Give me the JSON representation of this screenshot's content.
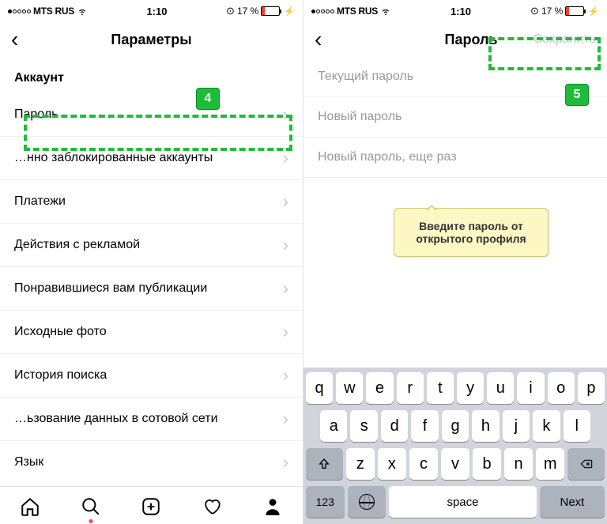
{
  "status": {
    "carrier": "MTS RUS",
    "time": "1:10",
    "battery": "17 %"
  },
  "left": {
    "title": "Параметры",
    "section": "Аккаунт",
    "rows": [
      "Пароль",
      "…нно заблокированные аккаунты",
      "Платежи",
      "Действия с рекламой",
      "Понравившиеся вам публикации",
      "Исходные фото",
      "История поиска",
      "…ьзование данных в сотовой сети",
      "Язык"
    ],
    "badge": "4"
  },
  "right": {
    "title": "Пароль",
    "save": "Сохранить",
    "placeholders": {
      "current": "Текущий пароль",
      "new": "Новый пароль",
      "again": "Новый пароль, еще раз"
    },
    "badge": "5"
  },
  "callout": "Введите пароль от открытого профиля",
  "keyboard": {
    "row1": [
      "q",
      "w",
      "e",
      "r",
      "t",
      "y",
      "u",
      "i",
      "o",
      "p"
    ],
    "row2": [
      "a",
      "s",
      "d",
      "f",
      "g",
      "h",
      "j",
      "k",
      "l"
    ],
    "row3": [
      "z",
      "x",
      "c",
      "v",
      "b",
      "n",
      "m"
    ],
    "n123": "123",
    "space": "space",
    "next": "Next"
  }
}
